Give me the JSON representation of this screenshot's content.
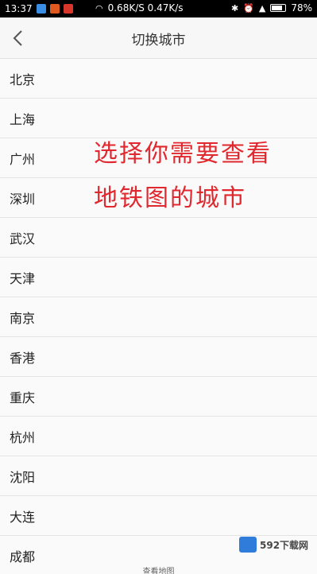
{
  "status_bar": {
    "time": "13:37",
    "speed": "0.68K/S 0.47K/s",
    "battery": "78%"
  },
  "header": {
    "back_icon": "chevron-left-icon",
    "title": "切换城市"
  },
  "cities": [
    "北京",
    "上海",
    "广州",
    "深圳",
    "武汉",
    "天津",
    "南京",
    "香港",
    "重庆",
    "杭州",
    "沈阳",
    "大连",
    "成都"
  ],
  "overlay": {
    "line1": "选择你需要查看",
    "line2": "地铁图的城市",
    "color": "#e0282e"
  },
  "watermark": {
    "text": "592下载网"
  },
  "footer": {
    "hint": "查看地图"
  }
}
